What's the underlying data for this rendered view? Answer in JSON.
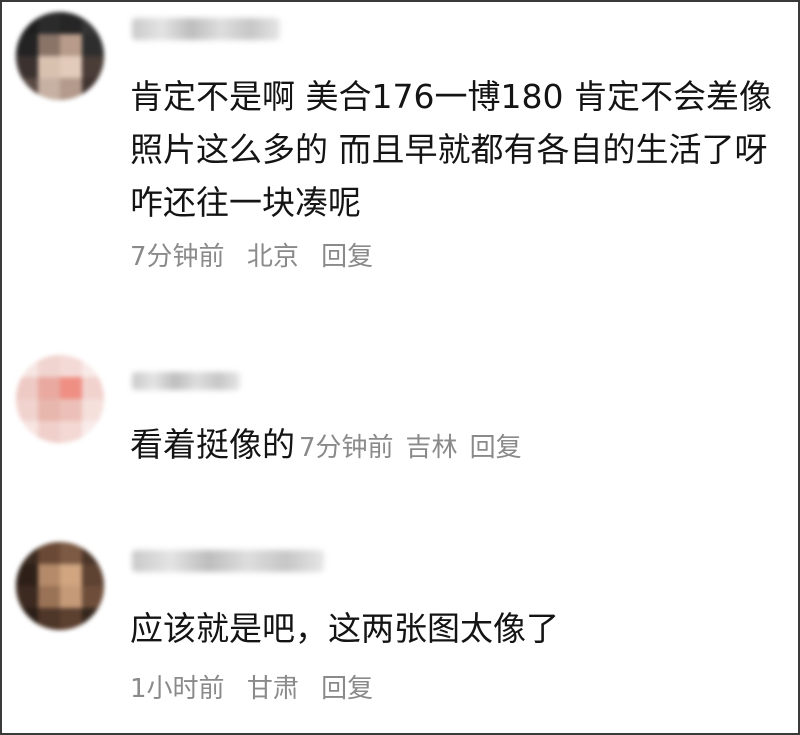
{
  "comments": [
    {
      "text": "肯定不是啊 美合176一博180 肯定不会差像照片这么多的 而且早就都有各自的生活了呀咋还往一块凑呢",
      "time": "7分钟前",
      "location": "北京",
      "reply_label": "回复"
    },
    {
      "text": "看着挺像的",
      "time": "7分钟前",
      "location": "吉林",
      "reply_label": "回复"
    },
    {
      "text": "应该就是吧，这两张图太像了",
      "time": "1小时前",
      "location": "甘肃",
      "reply_label": "回复"
    }
  ],
  "colors": {
    "text": "#141414",
    "meta": "#8a8a8a",
    "border": "#3a3a3a"
  }
}
